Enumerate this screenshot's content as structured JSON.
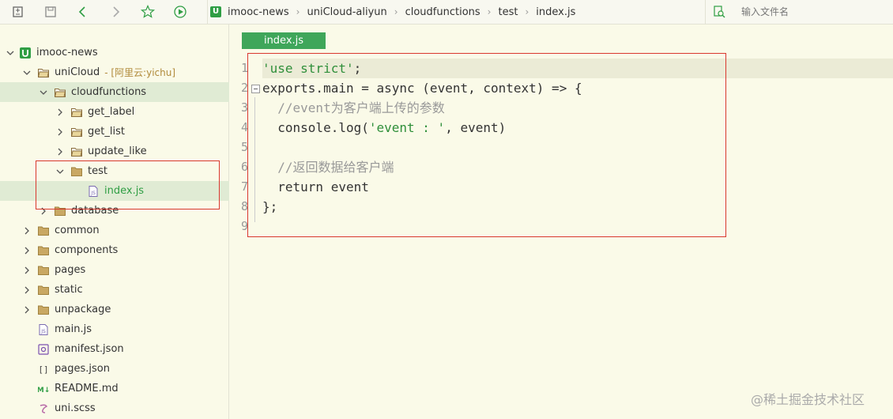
{
  "toolbar": {
    "icons": [
      "new-file-icon",
      "save-icon",
      "back-icon",
      "forward-icon",
      "star-icon",
      "run-icon"
    ]
  },
  "breadcrumb": {
    "logo": "U",
    "items": [
      "imooc-news",
      "uniCloud-aliyun",
      "cloudfunctions",
      "test",
      "index.js"
    ],
    "separator": "›"
  },
  "file_search": {
    "placeholder": "输入文件名"
  },
  "sidebar": {
    "tree": [
      {
        "label": "imooc-news",
        "note": "",
        "type": "project",
        "expanded": true
      },
      {
        "label": "uniCloud",
        "note": "- [阿里云:yichu]",
        "type": "folder-open",
        "expanded": true
      },
      {
        "label": "cloudfunctions",
        "note": "",
        "type": "folder-open",
        "expanded": true
      },
      {
        "label": "get_label",
        "note": "",
        "type": "folder-collapsed",
        "expanded": false
      },
      {
        "label": "get_list",
        "note": "",
        "type": "folder-collapsed",
        "expanded": false
      },
      {
        "label": "update_like",
        "note": "",
        "type": "folder-collapsed",
        "expanded": false
      },
      {
        "label": "test",
        "note": "",
        "type": "folder",
        "expanded": true
      },
      {
        "label": "index.js",
        "note": "",
        "type": "js-file",
        "expanded": false
      },
      {
        "label": "database",
        "note": "",
        "type": "folder",
        "expanded": false
      },
      {
        "label": "common",
        "note": "",
        "type": "folder",
        "expanded": false
      },
      {
        "label": "components",
        "note": "",
        "type": "folder",
        "expanded": false
      },
      {
        "label": "pages",
        "note": "",
        "type": "folder",
        "expanded": false
      },
      {
        "label": "static",
        "note": "",
        "type": "folder",
        "expanded": false
      },
      {
        "label": "unpackage",
        "note": "",
        "type": "folder",
        "expanded": false
      },
      {
        "label": "main.js",
        "note": "",
        "type": "js-file",
        "expanded": false
      },
      {
        "label": "manifest.json",
        "note": "",
        "type": "manifest-file",
        "expanded": false
      },
      {
        "label": "pages.json",
        "note": "",
        "type": "json-file",
        "expanded": false
      },
      {
        "label": "README.md",
        "note": "",
        "type": "markdown-file",
        "expanded": false
      },
      {
        "label": "uni.scss",
        "note": "",
        "type": "scss-file",
        "expanded": false
      }
    ]
  },
  "editor": {
    "tab_label": "index.js",
    "line_numbers": [
      "1",
      "2",
      "3",
      "4",
      "5",
      "6",
      "7",
      "8",
      "9"
    ],
    "code": {
      "l1_str": "'use strict'",
      "l1_end": ";",
      "l2_a": "exports.main = async ",
      "l2_b": "(event, context)",
      "l2_c": " => {",
      "l3": "  //event为客户端上传的参数",
      "l4_a": "  console.log(",
      "l4_str": "'event : '",
      "l4_b": ", event)",
      "l6": "  //返回数据给客户端",
      "l7": "  return event",
      "l8": "};"
    }
  },
  "watermark": "@稀土掘金技术社区",
  "colors": {
    "accent": "#3fa65a",
    "annotation": "#d9382f",
    "background": "#fafae8"
  }
}
